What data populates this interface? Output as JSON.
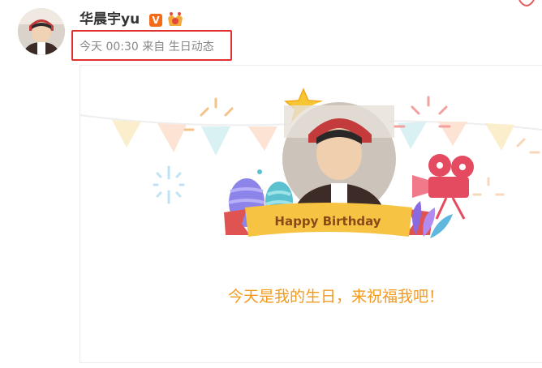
{
  "post": {
    "user_name": "华晨宇yu",
    "verified_mark": "V",
    "meta": "今天 00:30 来自 生日动态",
    "card": {
      "banner_text": "Happy Birthday",
      "message": "今天是我的生日，来祝福我吧！"
    }
  },
  "colors": {
    "highlight_box": "#e0312f",
    "message": "#f39a1e",
    "ribbon": "#f6c343",
    "verified": "#f46b17"
  },
  "icons": [
    "verified-icon",
    "member-crown-icon",
    "star-icon",
    "egg-icon",
    "camera-icon",
    "plant-icon",
    "sparkle-icon"
  ]
}
